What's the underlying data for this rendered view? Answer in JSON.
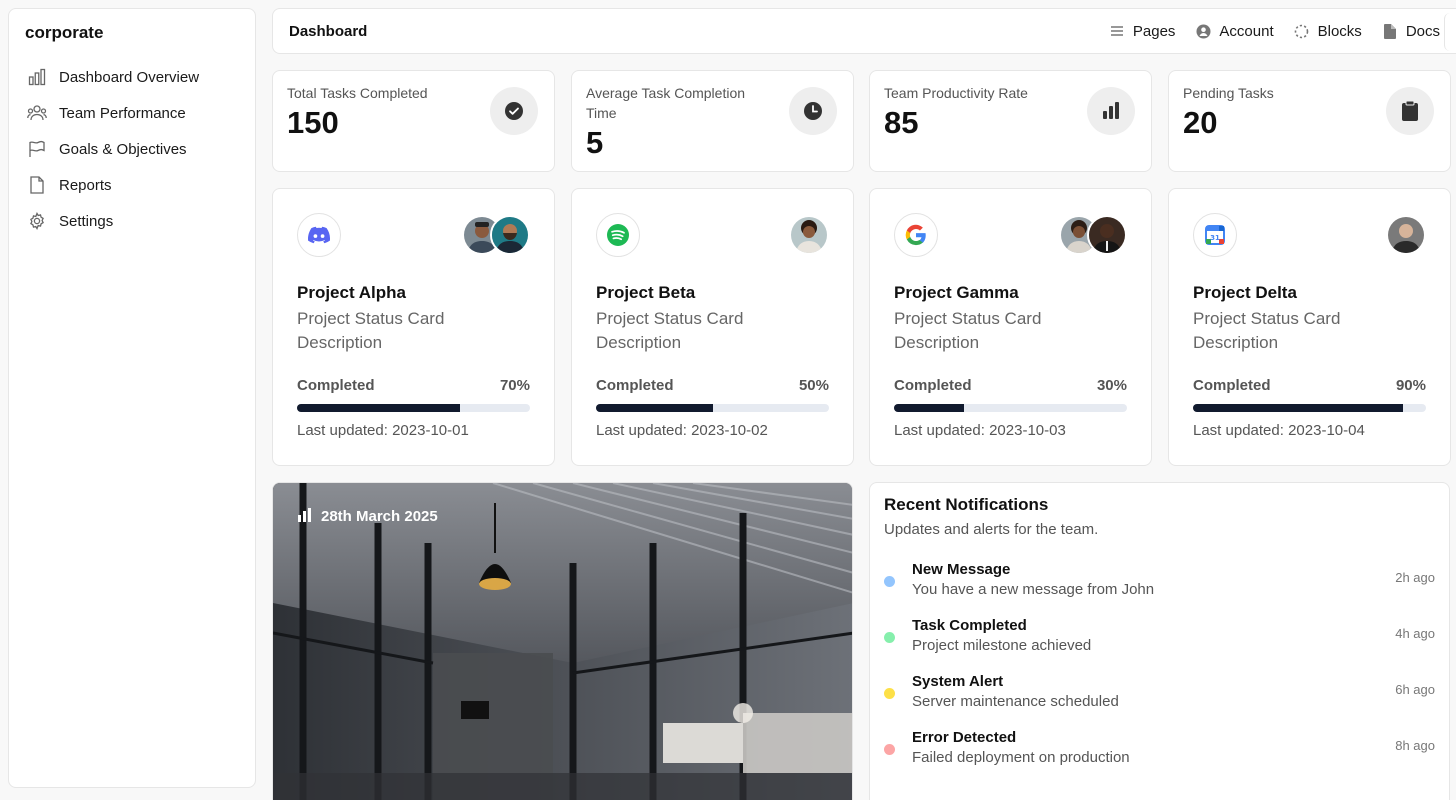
{
  "sidebar": {
    "brand": "corporate",
    "items": [
      {
        "label": "Dashboard Overview",
        "icon": "bar-chart-icon"
      },
      {
        "label": "Team Performance",
        "icon": "users-icon"
      },
      {
        "label": "Goals & Objectives",
        "icon": "flag-icon"
      },
      {
        "label": "Reports",
        "icon": "file-icon"
      },
      {
        "label": "Settings",
        "icon": "gear-icon"
      }
    ]
  },
  "header": {
    "title": "Dashboard",
    "nav": [
      {
        "label": "Pages",
        "icon": "menu-lines-icon"
      },
      {
        "label": "Account",
        "icon": "user-circle-icon"
      },
      {
        "label": "Blocks",
        "icon": "dotted-circle-icon"
      },
      {
        "label": "Docs",
        "icon": "document-icon"
      }
    ]
  },
  "stats": [
    {
      "label": "Total Tasks Completed",
      "value": "150",
      "icon": "check-circle-icon"
    },
    {
      "label": "Average Task Completion Time",
      "value": "5",
      "icon": "clock-icon"
    },
    {
      "label": "Team Productivity Rate",
      "value": "85",
      "icon": "bar-chart-icon"
    },
    {
      "label": "Pending Tasks",
      "value": "20",
      "icon": "clipboard-icon"
    }
  ],
  "projects": [
    {
      "name": "Project Alpha",
      "description": "Project Status Card Description",
      "status_label": "Completed",
      "percent_text": "70%",
      "progress": 0.7,
      "updated": "Last updated: 2023-10-01",
      "logo": "discord-logo-icon"
    },
    {
      "name": "Project Beta",
      "description": "Project Status Card Description",
      "status_label": "Completed",
      "percent_text": "50%",
      "progress": 0.5,
      "updated": "Last updated: 2023-10-02",
      "logo": "spotify-logo-icon"
    },
    {
      "name": "Project Gamma",
      "description": "Project Status Card Description",
      "status_label": "Completed",
      "percent_text": "30%",
      "progress": 0.3,
      "updated": "Last updated: 2023-10-03",
      "logo": "google-logo-icon"
    },
    {
      "name": "Project Delta",
      "description": "Project Status Card Description",
      "status_label": "Completed",
      "percent_text": "90%",
      "progress": 0.9,
      "updated": "Last updated: 2023-10-04",
      "logo": "google-calendar-logo-icon"
    }
  ],
  "hero": {
    "date": "28th March 2025",
    "icon": "bar-chart-icon"
  },
  "notifications": {
    "title": "Recent Notifications",
    "subtitle": "Updates and alerts for the team.",
    "items": [
      {
        "title": "New Message",
        "description": "You have a new message from John",
        "time": "2h ago",
        "color": "#93c5fd"
      },
      {
        "title": "Task Completed",
        "description": "Project milestone achieved",
        "time": "4h ago",
        "color": "#86efac"
      },
      {
        "title": "System Alert",
        "description": "Server maintenance scheduled",
        "time": "6h ago",
        "color": "#fde047"
      },
      {
        "title": "Error Detected",
        "description": "Failed deployment on production",
        "time": "8h ago",
        "color": "#fca5a5"
      }
    ]
  }
}
